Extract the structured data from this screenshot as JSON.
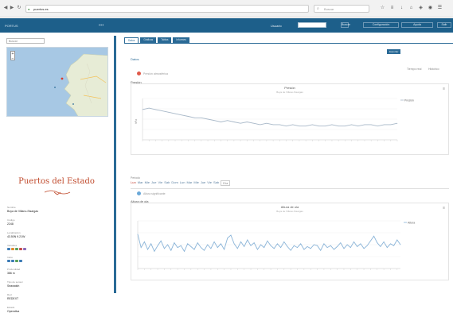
{
  "browser": {
    "url_domain": "puertos.es",
    "url_path": "",
    "search_placeholder": "Buscar"
  },
  "header": {
    "brand": "PORTUS",
    "user_label": "Usuario",
    "button_labels": [
      "Buscar",
      "Configuración",
      "Ayuda",
      "Salir"
    ]
  },
  "sidebar": {
    "search_placeholder": "Buscar",
    "title": "Puertos del Estado",
    "fields": [
      {
        "label": "Nombre",
        "value": "Boya de Villano-Sisargas"
      },
      {
        "label": "Código",
        "value": "2248"
      },
      {
        "label": "Localización",
        "value": "43.50N 9.21W"
      },
      {
        "label": "Variables",
        "value": ""
      },
      {
        "label": "Inicio",
        "value": "1998"
      },
      {
        "label": "Profundidad",
        "value": "386 m"
      },
      {
        "label": "Tipo de sensor",
        "value": "Seawatch"
      },
      {
        "label": "Red",
        "value": "REDEXT"
      },
      {
        "label": "Estado",
        "value": "Operativa"
      }
    ],
    "map_zoom": "+\n−"
  },
  "main": {
    "tabs": [
      "Datos",
      "Gráficas",
      "Tablas",
      "Informes"
    ],
    "export_label": "Exportar",
    "section_title": "Datos",
    "sub_links": [
      "Tiempo real",
      "Histórico"
    ],
    "chart1": {
      "panel_title": "Presión",
      "legend": "Presión atmosférica",
      "title": "Presión",
      "subtitle": "Boya de Villano-Sisargas",
      "ylabel": "hPa",
      "series_label": "Presión"
    },
    "mid_label": "Periodo",
    "day_labels": [
      "Lun",
      "Mar",
      "Mie",
      "Jue",
      "Vie",
      "Sab",
      "Dom",
      "Lun",
      "Mar",
      "Mie",
      "Jue",
      "Vie",
      "Sab"
    ],
    "day_select": "Día",
    "chart2": {
      "legend": "Altura significante",
      "panel_title": "Altura de ola",
      "title": "Altura de ola",
      "subtitle": "Boya de Villano-Sisargas",
      "series_label": "Altura"
    }
  },
  "colors": {
    "header": "#1d5f8a",
    "accent": "#2a6a96",
    "line": "#8ab4d8",
    "title": "#c04a2c"
  },
  "chart_data": [
    {
      "type": "line",
      "title": "Presión",
      "ylabel": "hPa",
      "x": [
        0,
        1,
        2,
        3,
        4,
        5,
        6,
        7,
        8,
        9,
        10,
        11,
        12,
        13,
        14,
        15,
        16,
        17,
        18,
        19,
        20,
        21,
        22,
        23,
        24,
        25,
        26,
        27,
        28,
        29,
        30,
        31,
        32,
        33,
        34,
        35,
        36,
        37,
        38,
        39
      ],
      "series": [
        {
          "name": "Presión",
          "values": [
            1022,
            1023,
            1022,
            1021,
            1020,
            1019,
            1018,
            1017,
            1016,
            1016,
            1015,
            1014,
            1013,
            1014,
            1013,
            1012,
            1013,
            1012,
            1011,
            1012,
            1011,
            1011,
            1010,
            1011,
            1010,
            1010,
            1011,
            1010,
            1010,
            1011,
            1010,
            1010,
            1011,
            1010,
            1011,
            1011,
            1010,
            1011,
            1011,
            1012
          ]
        }
      ]
    },
    {
      "type": "line",
      "title": "Altura de ola",
      "ylabel": "m",
      "x": [
        0,
        1,
        2,
        3,
        4,
        5,
        6,
        7,
        8,
        9,
        10,
        11,
        12,
        13,
        14,
        15,
        16,
        17,
        18,
        19,
        20,
        21,
        22,
        23,
        24,
        25,
        26,
        27,
        28,
        29,
        30,
        31,
        32,
        33,
        34,
        35,
        36,
        37,
        38,
        39,
        40,
        41,
        42,
        43,
        44,
        45,
        46,
        47,
        48,
        49,
        50,
        51,
        52,
        53,
        54,
        55,
        56,
        57,
        58,
        59,
        60,
        61,
        62,
        63,
        64,
        65,
        66,
        67,
        68,
        69,
        70,
        71,
        72,
        73,
        74,
        75,
        76,
        77,
        78,
        79
      ],
      "series": [
        {
          "name": "Altura",
          "values": [
            3.6,
            2.2,
            2.8,
            2.0,
            2.6,
            1.8,
            2.4,
            2.9,
            2.1,
            2.5,
            1.9,
            2.7,
            2.2,
            2.4,
            1.8,
            2.6,
            2.3,
            2.0,
            2.7,
            2.2,
            1.9,
            2.5,
            2.1,
            2.8,
            2.2,
            2.6,
            2.0,
            3.2,
            3.5,
            2.6,
            2.1,
            2.8,
            2.3,
            3.0,
            2.4,
            2.7,
            2.0,
            2.5,
            2.2,
            2.9,
            2.4,
            2.1,
            2.6,
            2.2,
            2.8,
            2.3,
            1.9,
            2.4,
            2.2,
            2.6,
            2.0,
            2.3,
            2.1,
            2.5,
            2.4,
            1.9,
            2.6,
            2.2,
            2.4,
            2.0,
            2.3,
            2.7,
            2.1,
            2.5,
            2.2,
            2.8,
            2.3,
            2.6,
            2.1,
            2.4,
            2.9,
            3.4,
            2.7,
            2.3,
            2.8,
            2.2,
            2.6,
            2.4,
            3.0,
            2.5
          ]
        }
      ]
    }
  ]
}
